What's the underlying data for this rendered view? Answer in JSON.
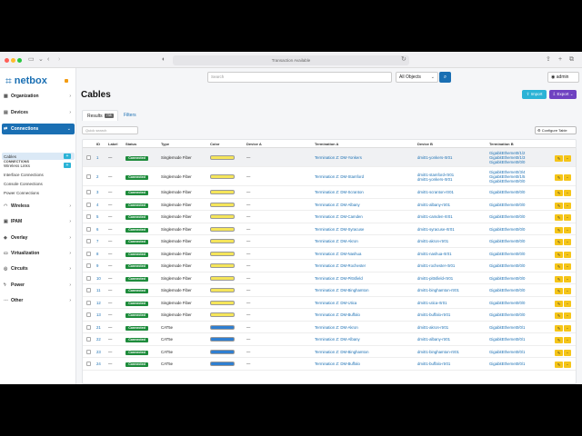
{
  "browser": {
    "url_text": "Transaction Available"
  },
  "brand": {
    "name": "netbox"
  },
  "sidebar": {
    "items": [
      {
        "label": "Organization",
        "icon": "domain-icon"
      },
      {
        "label": "Devices",
        "icon": "server-icon"
      },
      {
        "label": "Connections",
        "icon": "connection-icon"
      }
    ],
    "section_title": "CONNECTIONS",
    "subitems": [
      {
        "label": "Cables",
        "has_add": true
      },
      {
        "label": "Wireless Links",
        "has_add": true
      },
      {
        "label": "Interface Connections",
        "has_add": false
      },
      {
        "label": "Console Connections",
        "has_add": false
      },
      {
        "label": "Power Connections",
        "has_add": false
      }
    ],
    "items2": [
      {
        "label": "Wireless",
        "icon": "wifi-icon"
      },
      {
        "label": "IPAM",
        "icon": "ip-icon"
      },
      {
        "label": "Overlay",
        "icon": "overlay-icon"
      },
      {
        "label": "Virtualization",
        "icon": "monitor-icon"
      },
      {
        "label": "Circuits",
        "icon": "circuit-icon"
      },
      {
        "label": "Power",
        "icon": "flash-icon"
      },
      {
        "label": "Other",
        "icon": "dots-icon"
      }
    ]
  },
  "topbar": {
    "search_placeholder": "Search",
    "object_select": "All Objects",
    "user": "admin"
  },
  "page": {
    "title": "Cables",
    "import_label": "Import",
    "export_label": "Export"
  },
  "tabs": {
    "results_label": "Results",
    "results_count": "738",
    "filters_label": "Filters"
  },
  "table": {
    "quick_search_placeholder": "Quick search",
    "configure_label": "Configure Table",
    "columns": [
      "ID",
      "Label",
      "Status",
      "Type",
      "Color",
      "Device A",
      "Termination A",
      "Device B",
      "Termination B"
    ],
    "rows": [
      {
        "id": "1",
        "label": "—",
        "status": "Connected",
        "type": "Singlemode Fiber",
        "color": "#f5e55a",
        "device_a": "—",
        "term_a": "Termination Z: DM-Yonkers",
        "device_b": [
          "dmi01-yonkers-rtr01"
        ],
        "term_b": [
          "GigabitEthernet0/1/2",
          "GigabitEthernet0/1/3",
          "GigabitEthernet0/0/0"
        ]
      },
      {
        "id": "2",
        "label": "—",
        "status": "Connected",
        "type": "Singlemode Fiber",
        "color": "#f5e55a",
        "device_a": "—",
        "term_a": "Termination Z: DM-Stamford",
        "device_b": [
          "dmi01-stamford-rtr01",
          "dmi01-yonkers-rtr01"
        ],
        "term_b": [
          "GigabitEthernet0/3/4",
          "GigabitEthernet0/1/5",
          "GigabitEthernet0/0/0"
        ]
      },
      {
        "id": "3",
        "label": "—",
        "status": "Connected",
        "type": "Singlemode Fiber",
        "color": "#f5e55a",
        "device_a": "—",
        "term_a": "Termination Z: DM-Scranton",
        "device_b": [
          "dmi01-scranton-rtr01"
        ],
        "term_b": [
          "GigabitEthernet0/0/0"
        ]
      },
      {
        "id": "4",
        "label": "—",
        "status": "Connected",
        "type": "Singlemode Fiber",
        "color": "#f5e55a",
        "device_a": "—",
        "term_a": "Termination Z: DM-Albany",
        "device_b": [
          "dmi01-albany-rtr01"
        ],
        "term_b": [
          "GigabitEthernet0/0/0"
        ]
      },
      {
        "id": "5",
        "label": "—",
        "status": "Connected",
        "type": "Singlemode Fiber",
        "color": "#f5e55a",
        "device_a": "—",
        "term_a": "Termination Z: DM-Camden",
        "device_b": [
          "dmi01-camden-rtr01"
        ],
        "term_b": [
          "GigabitEthernet0/0/0"
        ]
      },
      {
        "id": "6",
        "label": "—",
        "status": "Connected",
        "type": "Singlemode Fiber",
        "color": "#f5e55a",
        "device_a": "—",
        "term_a": "Termination Z: DM-Syracuse",
        "device_b": [
          "dmi01-syracuse-rtr01"
        ],
        "term_b": [
          "GigabitEthernet0/0/0"
        ]
      },
      {
        "id": "7",
        "label": "—",
        "status": "Connected",
        "type": "Singlemode Fiber",
        "color": "#f5e55a",
        "device_a": "—",
        "term_a": "Termination Z: DM-Akron",
        "device_b": [
          "dmi01-akron-rtr01"
        ],
        "term_b": [
          "GigabitEthernet0/0/0"
        ]
      },
      {
        "id": "8",
        "label": "—",
        "status": "Connected",
        "type": "Singlemode Fiber",
        "color": "#f5e55a",
        "device_a": "—",
        "term_a": "Termination Z: DM-Nashua",
        "device_b": [
          "dmi01-nashua-rtr01"
        ],
        "term_b": [
          "GigabitEthernet0/0/0"
        ]
      },
      {
        "id": "9",
        "label": "—",
        "status": "Connected",
        "type": "Singlemode Fiber",
        "color": "#f5e55a",
        "device_a": "—",
        "term_a": "Termination Z: DM-Rochester",
        "device_b": [
          "dmi01-rochester-rtr01"
        ],
        "term_b": [
          "GigabitEthernet0/0/0"
        ]
      },
      {
        "id": "10",
        "label": "—",
        "status": "Connected",
        "type": "Singlemode Fiber",
        "color": "#f5e55a",
        "device_a": "—",
        "term_a": "Termination Z: DM-Pittsfield",
        "device_b": [
          "dmi01-pittsfield-rtr01"
        ],
        "term_b": [
          "GigabitEthernet0/0/0"
        ]
      },
      {
        "id": "11",
        "label": "—",
        "status": "Connected",
        "type": "Singlemode Fiber",
        "color": "#f5e55a",
        "device_a": "—",
        "term_a": "Termination Z: DM-Binghamton",
        "device_b": [
          "dmi01-binghamton-rtr01"
        ],
        "term_b": [
          "GigabitEthernet0/0/0"
        ]
      },
      {
        "id": "12",
        "label": "—",
        "status": "Connected",
        "type": "Singlemode Fiber",
        "color": "#f5e55a",
        "device_a": "—",
        "term_a": "Termination Z: DM-Utica",
        "device_b": [
          "dmi01-utica-rtr01"
        ],
        "term_b": [
          "GigabitEthernet0/0/0"
        ]
      },
      {
        "id": "13",
        "label": "—",
        "status": "Connected",
        "type": "Singlemode Fiber",
        "color": "#f5e55a",
        "device_a": "—",
        "term_a": "Termination Z: DM-Buffalo",
        "device_b": [
          "dmi01-buffalo-rtr01"
        ],
        "term_b": [
          "GigabitEthernet0/0/0"
        ]
      },
      {
        "id": "21",
        "label": "—",
        "status": "Connected",
        "type": "CAT5e",
        "color": "#2f7fd1",
        "device_a": "—",
        "term_a": "Termination Z: DM-Akron",
        "device_b": [
          "dmi01-akron-rtr01"
        ],
        "term_b": [
          "GigabitEthernet0/0/1"
        ]
      },
      {
        "id": "22",
        "label": "—",
        "status": "Connected",
        "type": "CAT5e",
        "color": "#2f7fd1",
        "device_a": "—",
        "term_a": "Termination Z: DM-Albany",
        "device_b": [
          "dmi01-albany-rtr01"
        ],
        "term_b": [
          "GigabitEthernet0/0/1"
        ]
      },
      {
        "id": "23",
        "label": "—",
        "status": "Connected",
        "type": "CAT5e",
        "color": "#2f7fd1",
        "device_a": "—",
        "term_a": "Termination Z: DM-Binghamton",
        "device_b": [
          "dmi01-binghamton-rtr01"
        ],
        "term_b": [
          "GigabitEthernet0/0/1"
        ]
      },
      {
        "id": "24",
        "label": "—",
        "status": "Connected",
        "type": "CAT5e",
        "color": "#2f7fd1",
        "device_a": "—",
        "term_a": "Termination Z: DM-Buffalo",
        "device_b": [
          "dmi01-buffalo-rtr01"
        ],
        "term_b": [
          "GigabitEthernet0/0/1"
        ]
      }
    ]
  }
}
